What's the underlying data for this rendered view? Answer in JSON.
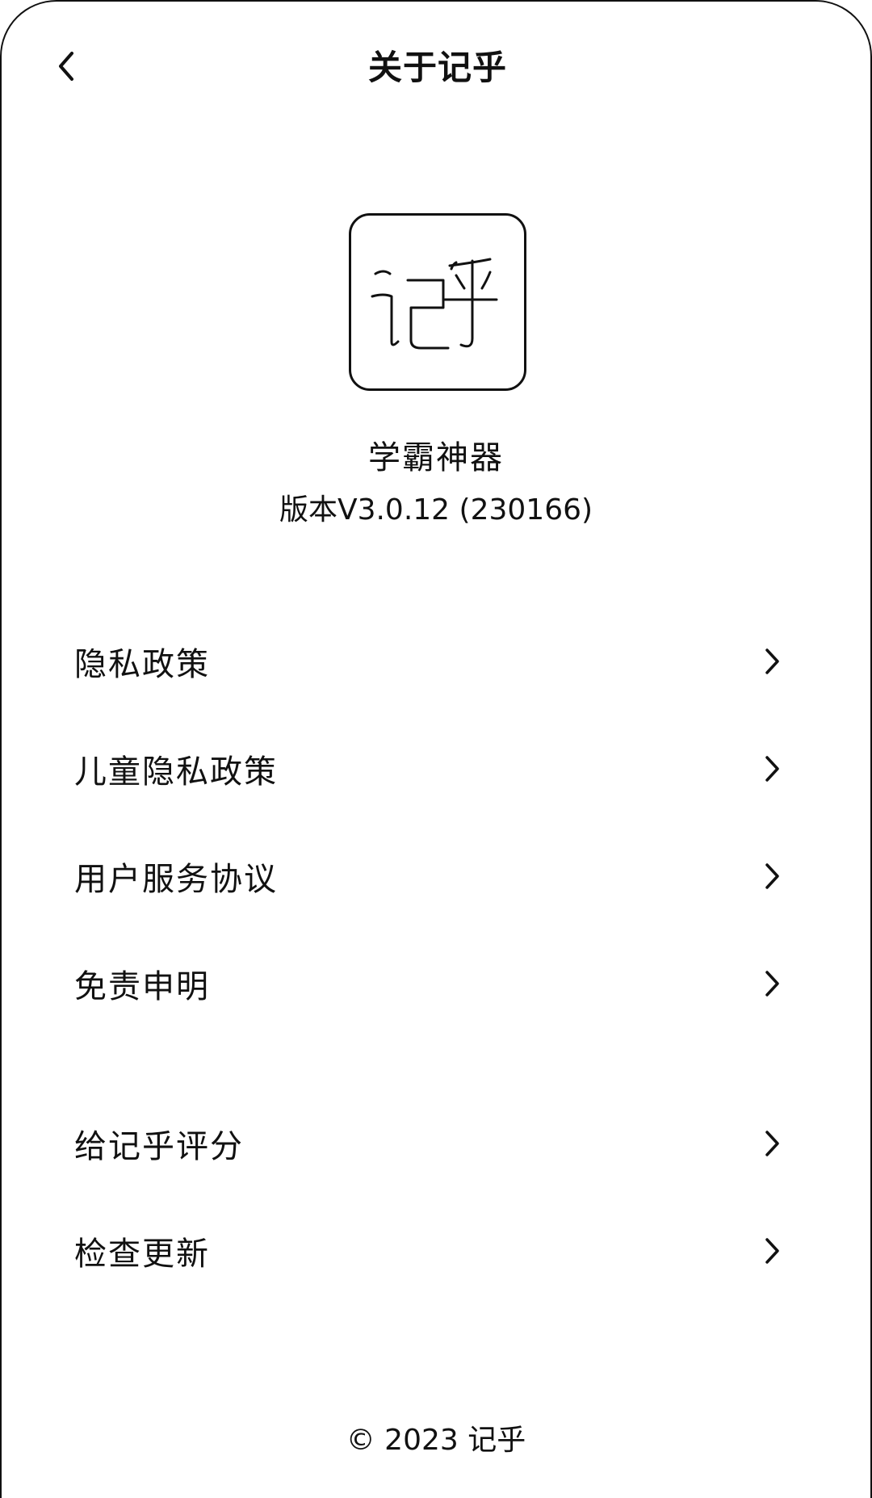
{
  "header": {
    "title": "关于记乎",
    "back_icon": "chevron-left-icon"
  },
  "app": {
    "logo_text": "记乎",
    "name": "学霸神器",
    "version": "版本V3.0.12 (230166)"
  },
  "menu": {
    "group1": [
      {
        "label": "隐私政策",
        "icon": "chevron-right-icon"
      },
      {
        "label": "儿童隐私政策",
        "icon": "chevron-right-icon"
      },
      {
        "label": "用户服务协议",
        "icon": "chevron-right-icon"
      },
      {
        "label": "免责申明",
        "icon": "chevron-right-icon"
      }
    ],
    "group2": [
      {
        "label": "给记乎评分",
        "icon": "chevron-right-icon"
      },
      {
        "label": "检查更新",
        "icon": "chevron-right-icon"
      }
    ]
  },
  "footer": {
    "copyright": "© 2023 记乎"
  },
  "colors": {
    "text": "#111111",
    "background": "#ffffff"
  }
}
